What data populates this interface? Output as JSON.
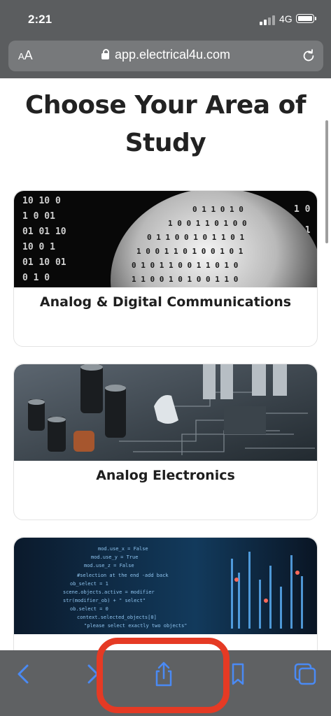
{
  "status_bar": {
    "time": "2:21",
    "network": "4G"
  },
  "url_bar": {
    "aa_label": "AA",
    "url": "app.electrical4u.com"
  },
  "page": {
    "heading": "Choose Your Area of Study",
    "cards": [
      {
        "title": "Analog & Digital Communications",
        "image": "binary-sphere-image"
      },
      {
        "title": "Analog Electronics",
        "image": "circuit-board-image"
      },
      {
        "title": "",
        "image": "code-screen-image"
      }
    ]
  },
  "toolbar": {
    "buttons": [
      "back-icon",
      "forward-icon",
      "share-icon",
      "bookmarks-icon",
      "tabs-icon"
    ]
  },
  "colors": {
    "chrome": "#5b5d5f",
    "toolbar_icon": "#4a8af4",
    "highlight": "#e53a24"
  }
}
